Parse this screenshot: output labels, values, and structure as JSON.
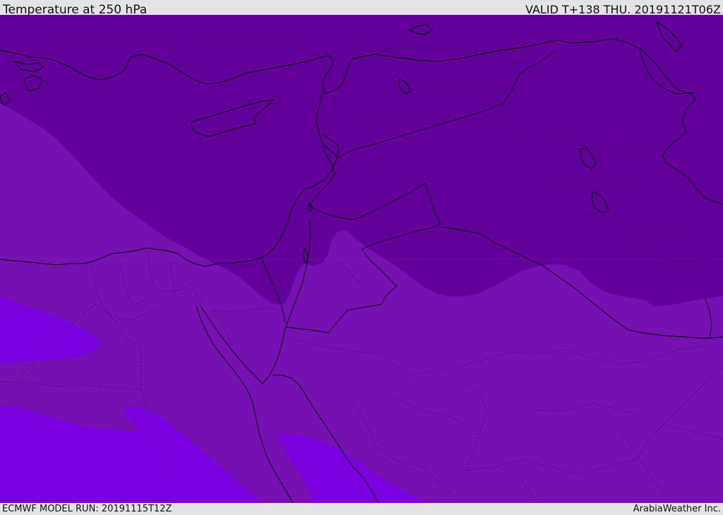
{
  "header": {
    "title": "Temperature at 250 hPa",
    "valid_time": "VALID T+138 THU. 20191121T06Z"
  },
  "footer": {
    "model_run": "ECMWF MODEL RUN: 20191115T12Z",
    "credit": "ArabiaWeather Inc."
  },
  "map": {
    "colors": {
      "coldest_band": "#64009a",
      "cold_band": "#7710b0",
      "warm_band": "#7b00e0",
      "coastline": "#000000",
      "border_dotted": "#2a0040"
    },
    "layers": [
      "temperature-fill",
      "coastlines",
      "national-borders",
      "province-borders"
    ]
  }
}
